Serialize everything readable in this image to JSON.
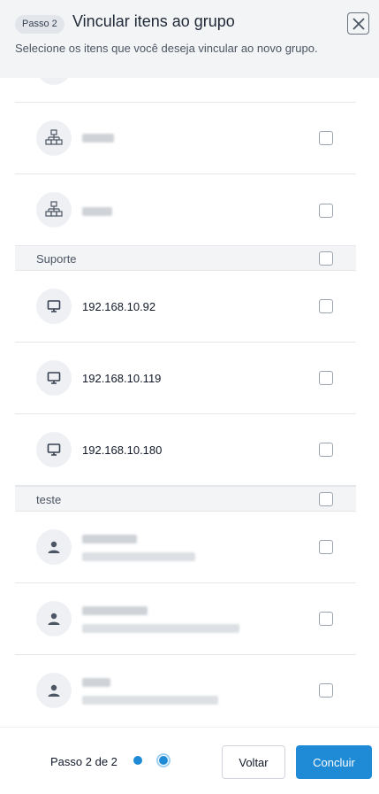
{
  "header": {
    "step_badge": "Passo 2",
    "title": "Vincular itens ao grupo",
    "subtitle": "Selecione os itens que você deseja vincular ao novo grupo."
  },
  "groups": {
    "suporte": {
      "label": "Suporte"
    },
    "teste": {
      "label": "teste"
    }
  },
  "items": {
    "device1": {
      "label": "192.168.10.92",
      "icon": "monitor-icon"
    },
    "device2": {
      "label": "192.168.10.119",
      "icon": "monitor-icon"
    },
    "device3": {
      "label": "192.168.10.180",
      "icon": "monitor-icon"
    },
    "network_icon": "network-icon",
    "user_icon": "user-icon"
  },
  "footer": {
    "step_text": "Passo 2 de 2",
    "back_label": "Voltar",
    "finish_label": "Concluir"
  },
  "colors": {
    "accent": "#1f8ad6",
    "header_bg": "#f3f4f6"
  }
}
